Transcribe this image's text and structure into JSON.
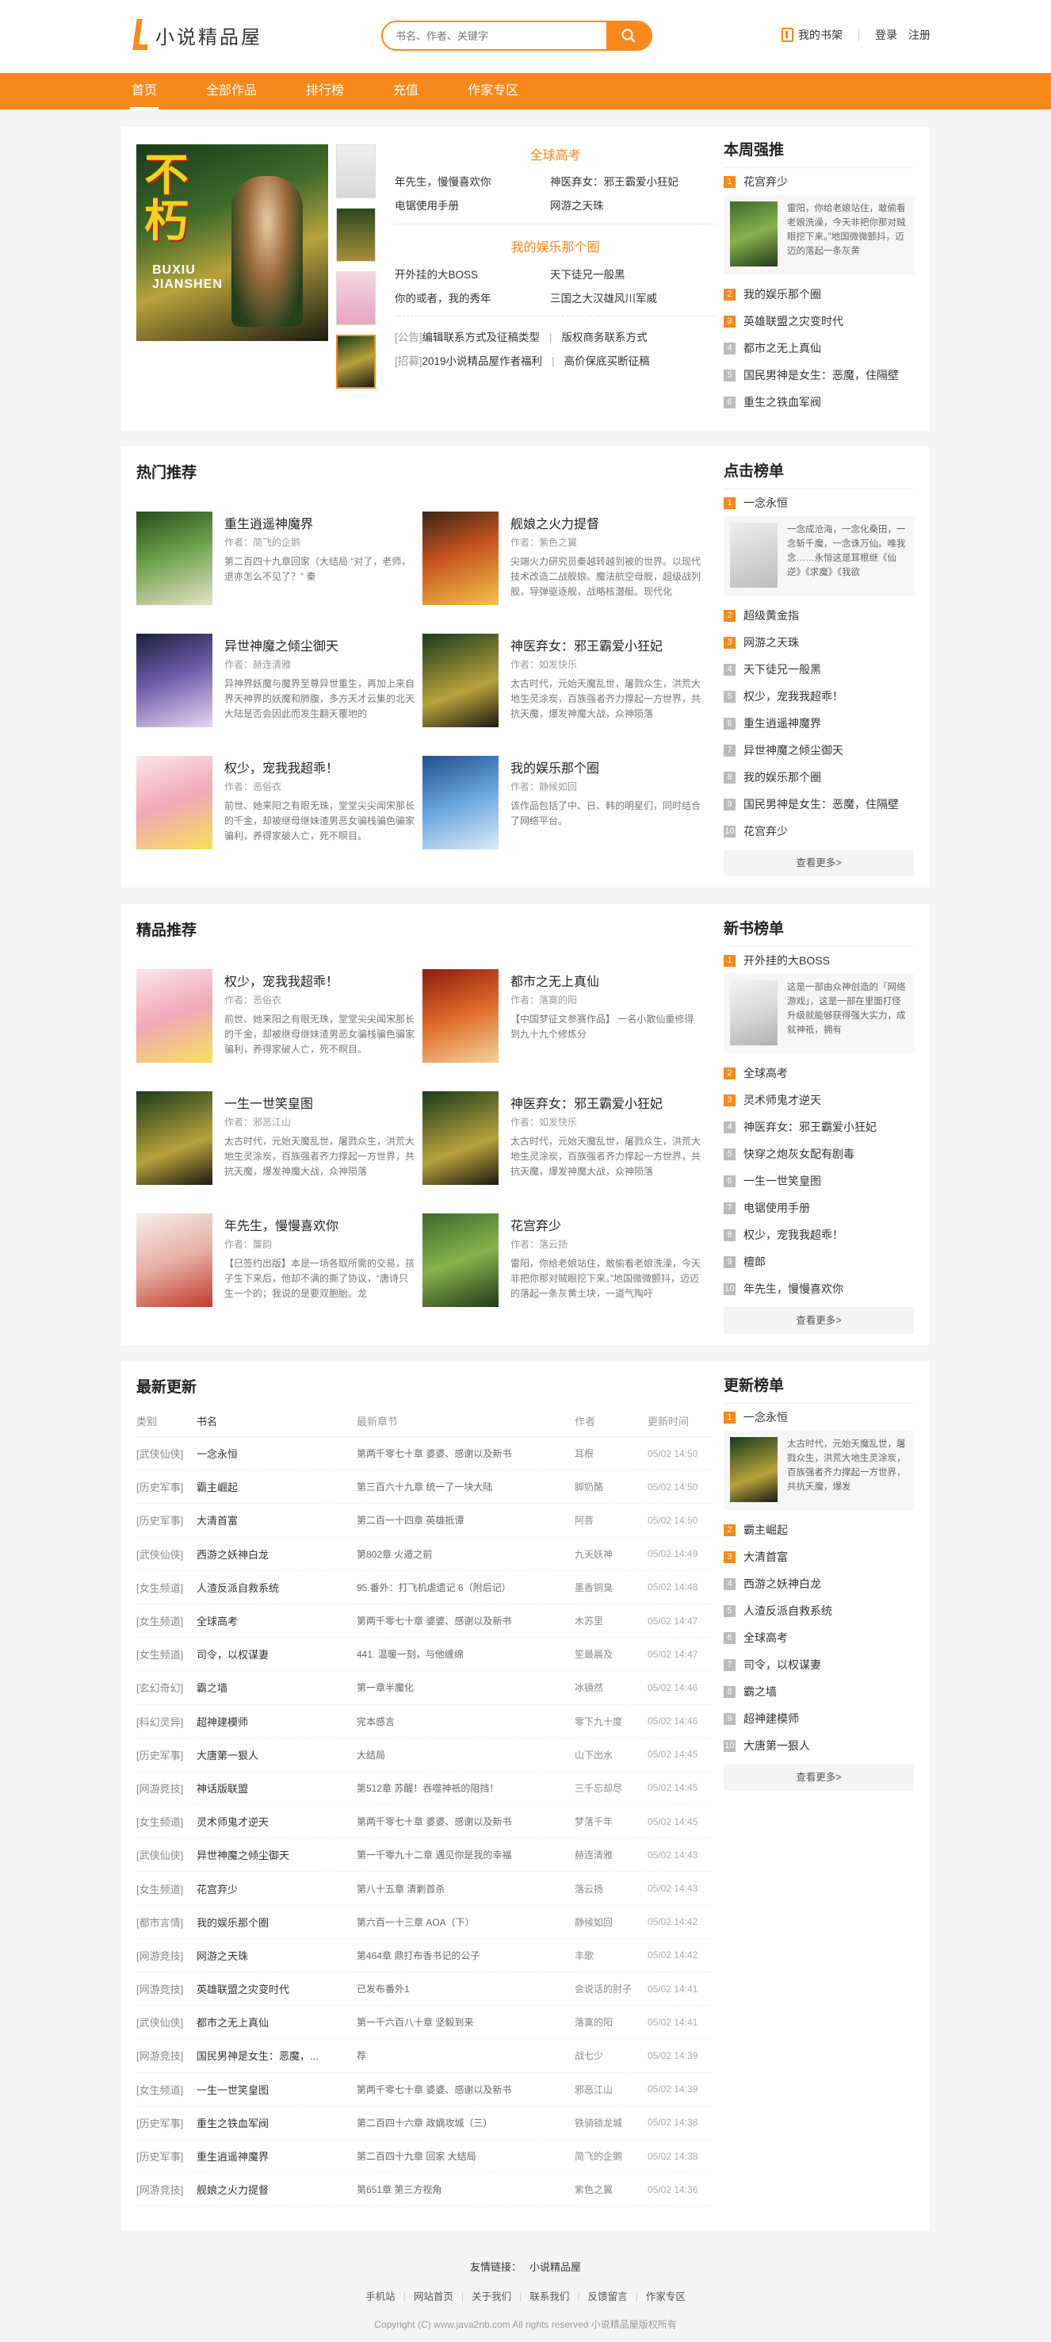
{
  "header": {
    "logo_text": "小说精品屋",
    "search_placeholder": "书名、作者、关键字",
    "shelf": "我的书架",
    "login": "登录",
    "register": "注册"
  },
  "nav": [
    "首页",
    "全部作品",
    "排行榜",
    "充值",
    "作家专区"
  ],
  "hot": {
    "heading1": "全球高考",
    "links1": [
      "年先生，慢慢喜欢你",
      "神医弃女：邪王霸爱小狂妃",
      "电锯使用手册",
      "网游之天珠"
    ],
    "heading2": "我的娱乐那个圈",
    "links2": [
      "开外挂的大BOSS",
      "天下徒兄一般黑",
      "你的或者，我的秀年",
      "三国之大汉雄风川军威"
    ],
    "notices": [
      {
        "tag": "[公告]",
        "text": "编辑联系方式及征稿类型",
        "right": "版权商务联系方式"
      },
      {
        "tag": "[招募]",
        "text": "2019小说精品屋作者福利",
        "right": "高价保底买断征稿"
      }
    ]
  },
  "weekly": {
    "title": "本周强推",
    "items": [
      "花宫弃少",
      "我的娱乐那个圈",
      "英雄联盟之灾变时代",
      "都市之无上真仙",
      "国民男神是女生：恶魔，住隔壁",
      "重生之铁血军阀"
    ],
    "card_desc": "雷阳，你给老娘站住，敢偷看老娘洗澡，今天非把你那对贼眼挖下来。”地国微微颤抖，迈迈的落起一条灰黄"
  },
  "hot_rec": {
    "title": "热门推荐",
    "books": [
      {
        "name": "重生逍遥神魔界",
        "author": "作者：简飞的企鹅",
        "desc": "第二百四十九章回家（大结局\n“对了，老师，退亦怎么不见了？” 秦"
      },
      {
        "name": "舰娘之火力提督",
        "author": "作者：紫色之翼",
        "desc": "尖端火力研究员秦越转越到被的世界。以现代技术改造二战舰娘。魔法航空母舰，超级战列舰，导弹驱逐舰，战略核潜艇。现代化"
      },
      {
        "name": "异世神魔之倾尘御天",
        "author": "作者：赫连清雅",
        "desc": "异神界妖魔与魔界至尊异世重生，再加上来自界天神界的妖魔和肺腹，多方天才云集的北天大陆是否会因此而发生翻天覆地的"
      },
      {
        "name": "神医弃女：邪王霸爱小狂妃",
        "author": "作者：如发快乐",
        "desc": "太古时代，元始天魔乱世，屠戮众生，洪荒大地生灵涂炭，百族强者齐力撑起一方世界，共抗天魔，爆发神魔大战，众神陨落"
      },
      {
        "name": "权少，宠我我超乖！",
        "author": "作者：恶俗衣",
        "desc": "前世、她来阳之有眼无珠，堂堂尖尖闻宋那长的千金，却被继母继妹渣男恶女骗栈骗色骗家骗利，养得家破人亡，死不瞑目。"
      },
      {
        "name": "我的娱乐那个圈",
        "author": "作者：静候如回",
        "desc": "该作品包括了中、日、韩的明星们，同时结合了网络平台。"
      }
    ]
  },
  "click_rank": {
    "title": "点击榜单",
    "items": [
      "一念永恒",
      "超级黄金指",
      "网游之天珠",
      "天下徒兄一般黑",
      "权少，宠我我超乖！",
      "重生逍遥神魔界",
      "异世神魔之倾尘御天",
      "我的娱乐那个圈",
      "国民男神是女生：恶魔，住隔壁",
      "花宫弃少"
    ],
    "card_desc": "一念成沧海，一念化桑田，一念斩千魔，一念诛万仙。唯我念……永恒这是耳根继《仙逆》《求魔》《我欲",
    "more": "查看更多>"
  },
  "fine_rec": {
    "title": "精品推荐",
    "books": [
      {
        "name": "权少，宠我我超乖！",
        "author": "作者：恶俗衣",
        "desc": "前世、她来阳之有眼无珠，堂堂尖尖闻宋那长的千金，却被继母继妹渣男恶女骗栈骗色骗家骗利，养得家破人亡，死不瞑目。"
      },
      {
        "name": "都市之无上真仙",
        "author": "作者：落寞的阳",
        "desc": "【中国梦征文参赛作品】\n一名小散仙重修得到九十九个修炼分"
      },
      {
        "name": "一生一世笑皇图",
        "author": "作者：邪恶江山",
        "desc": "太古时代，元始天魔乱世，屠戮众生，洪荒大地生灵涂炭，百族强者齐力撑起一方世界，共抗天魔，爆发神魔大战，众神陨落"
      },
      {
        "name": "神医弃女：邪王霸爱小狂妃",
        "author": "作者：如发快乐",
        "desc": "太古时代，元始天魔乱世，屠戮众生，洪荒大地生灵涂炭，百族强者齐力撑起一方世界，共抗天魔，爆发神魔大战，众神陨落"
      },
      {
        "name": "年先生，慢慢喜欢你",
        "author": "作者：簾韵",
        "desc": "【已签约出版】本是一场各取所需的交易，孩子生下来后，他却不满的撕了协议，“唐诗只生一个的；我说的是要双胞胎。龙"
      },
      {
        "name": "花宫弃少",
        "author": "作者：落云扬",
        "desc": "雷阳，你给老娘站住，敢偷看老娘洗澡，今天非把你那对贼眼挖下来。”地国微微颤抖，迈迈的落起一条灰黄土块，一道气陶吁"
      }
    ]
  },
  "new_rank": {
    "title": "新书榜单",
    "items": [
      "开外挂的大BOSS",
      "全球高考",
      "灵术师鬼才逆天",
      "神医弃女：邪王霸爱小狂妃",
      "快穿之炮灰女配有剧毒",
      "一生一世笑皇图",
      "电锯使用手册",
      "权少，宠我我超乖！",
      "檀郎",
      "年先生，慢慢喜欢你"
    ],
    "card_desc": "这是一部由众神创造的「网络游戏」，这是一部在里面打怪升级就能够获得强大实力，成就神祗，拥有",
    "more": "查看更多>"
  },
  "updates": {
    "title": "最新更新",
    "headers": [
      "类别",
      "书名",
      "最新章节",
      "作者",
      "更新时间"
    ],
    "rows": [
      [
        "[武侠仙侠]",
        "一念永恒",
        "第两千零七十章 婆婆、感谢以及新书",
        "耳根",
        "05/02 14:50"
      ],
      [
        "[历史军事]",
        "霸主崛起",
        "第三百六十九章 统一了一块大陆",
        "脚奶酪",
        "05/02 14:50"
      ],
      [
        "[历史军事]",
        "大清首富",
        "第二百一十四章 英雄抵谭",
        "阿菩",
        "05/02 14:50"
      ],
      [
        "[武侠仙侠]",
        "西游之妖神白龙",
        "第802章 火遁之前",
        "九天妖神",
        "05/02 14:49"
      ],
      [
        "[女生频道]",
        "人渣反派自救系统",
        "95.番外：打飞机虐遗记 6（附后记）",
        "墨香铜臭",
        "05/02 14:48"
      ],
      [
        "[女生频道]",
        "全球高考",
        "第两千零七十章 婆婆、感谢以及新书",
        "木苏里",
        "05/02 14:47"
      ],
      [
        "[女生频道]",
        "司令，以权谋妻",
        "441. 温暖一刻，与他缠绵",
        "笙最晨及",
        "05/02 14:47"
      ],
      [
        "[玄幻奇幻]",
        "霸之墙",
        "第一章半魔化",
        "冰镜然",
        "05/02 14:46"
      ],
      [
        "[科幻灵异]",
        "超神建模师",
        "完本感言",
        "零下九十度",
        "05/02 14:46"
      ],
      [
        "[历史军事]",
        "大唐第一狠人",
        "大结局",
        "山下出水",
        "05/02 14:45"
      ],
      [
        "[网游竞技]",
        "神话版联盟",
        "第512章 苏醒！吞噬神祇的阻挡！",
        "三千忘却尽",
        "05/02 14:45"
      ],
      [
        "[女生频道]",
        "灵术师鬼才逆天",
        "第两千零七十章 婆婆、感谢以及新书",
        "梦落千年",
        "05/02 14:45"
      ],
      [
        "[武侠仙侠]",
        "异世神魔之倾尘御天",
        "第一千零九十二章 遇见你是我的幸福",
        "赫连清雅",
        "05/02 14:43"
      ],
      [
        "[女生频道]",
        "花宫弃少",
        "第八十五章 清剿首杀",
        "落云扬",
        "05/02 14:43"
      ],
      [
        "[都市言情]",
        "我的娱乐那个圈",
        "第六百一十三章 AOA（下）",
        "静候如回",
        "05/02 14:42"
      ],
      [
        "[网游竞技]",
        "网游之天珠",
        "第464章 鼎打布香书记的公子",
        "丰歌",
        "05/02 14:42"
      ],
      [
        "[网游竞技]",
        "英雄联盟之灾变时代",
        "已发布番外1",
        "会说话的肘子",
        "05/02 14:41"
      ],
      [
        "[武侠仙侠]",
        "都市之无上真仙",
        "第一千六百八十章 坚毅到来",
        "落寞的阳",
        "05/02 14:41"
      ],
      [
        "[网游竞技]",
        "国民男神是女生：恶魔，...",
        "荐",
        "战七少",
        "05/02 14:39"
      ],
      [
        "[女生频道]",
        "一生一世笑皇图",
        "第两千零七十章 婆婆、感谢以及新书",
        "邪恶江山",
        "05/02 14:39"
      ],
      [
        "[历史军事]",
        "重生之铁血军阀",
        "第二百四十六章 政嫡攻城（三）",
        "铁骑锁龙城",
        "05/02 14:38"
      ],
      [
        "[历史军事]",
        "重生逍遥神魔界",
        "第二百四十九章 回家 大结局",
        "简飞的企鹅",
        "05/02 14:38"
      ],
      [
        "[网游竞技]",
        "舰娘之火力提督",
        "第651章 第三方视角",
        "紫色之翼",
        "05/02 14:36"
      ]
    ]
  },
  "update_rank": {
    "title": "更新榜单",
    "items": [
      "一念永恒",
      "霸主崛起",
      "大清首富",
      "西游之妖神白龙",
      "人渣反派自救系统",
      "全球高考",
      "司令，以权谋妻",
      "霸之墙",
      "超神建模师",
      "大唐第一狠人"
    ],
    "card_desc": "太古时代，元始天魔乱世，屠戮众生，洪荒大地生灵涂炭，百族强者齐力撑起一方世界，共抗天魔，爆发",
    "more": "查看更多>"
  },
  "footer": {
    "friend_label": "友情链接：",
    "friend_link": "小说精品屋",
    "links": [
      "手机站",
      "网站首页",
      "关于我们",
      "联系我们",
      "反馈留言",
      "作家专区"
    ],
    "copyright": "Copyright (C) www.java2nb.com All rights reserved  小说精品屋版权所有"
  },
  "colors": {
    "accent": "#f7881a"
  }
}
